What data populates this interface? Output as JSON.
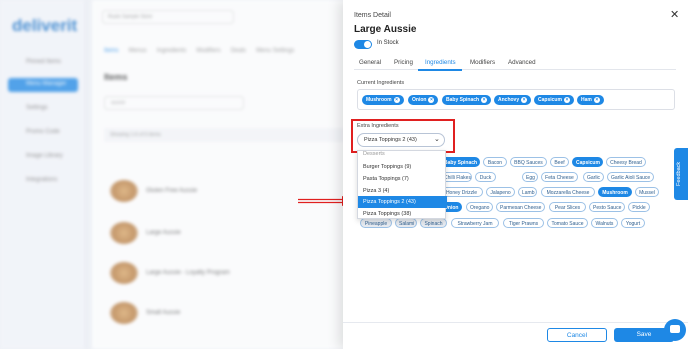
{
  "background": {
    "logo": "deliverit",
    "store_select": "Ruslo Sample Store",
    "nav": [
      "Pinned Items",
      "Menu Manager",
      "Settings",
      "Promo Code",
      "Image Library",
      "Integrations"
    ],
    "tabs": [
      "Items",
      "Menus",
      "Ingredients",
      "Modifiers",
      "Deals",
      "Menu Settings"
    ],
    "items_title": "Items",
    "search_value": "aussie",
    "showing": "Showing 1-6 of 6 items",
    "column": "Name",
    "rows": [
      "Gluten Free Aussie",
      "Large Aussie",
      "Large Aussie - Loyalty Program",
      "Small Aussie"
    ]
  },
  "panel": {
    "header": "Items Detail",
    "item_name": "Large Aussie",
    "in_stock_label": "In Stock",
    "tabs": [
      "General",
      "Pricing",
      "Ingredients",
      "Modifiers",
      "Advanced"
    ],
    "active_tab": "Ingredients",
    "current_label": "Current Ingredients",
    "current_ingredients": [
      "Mushroom",
      "Onion",
      "Baby Spinach",
      "Anchovy",
      "Capsicum",
      "Ham"
    ],
    "extra_label": "Extra Ingredients",
    "extra_selected": "Pizza Toppings 2 (43)",
    "dropdown_options": [
      "Desserts",
      "Burger Toppings (9)",
      "Pasta Toppings (7)",
      "Pizza 3 (4)",
      "Pizza Toppings 2 (43)",
      "Pizza Toppings (38)"
    ],
    "chips_row1": [
      "Baby Spinach",
      "Bacon",
      "BBQ Sauces",
      "Beef",
      "Capsicum",
      "Cheesy Bread"
    ],
    "chips_row2": [
      "Chilli Flakes",
      "Duck",
      "Egg",
      "Feta Cheese",
      "Garlic",
      "Garlic Aioli Sauce"
    ],
    "chips_row3": [
      "Honey Drizzle",
      "Jalapeno",
      "Lamb",
      "Mozzarella Cheese",
      "Mushroom",
      "Mussel"
    ],
    "chips_row4": [
      "Onion",
      "Oregano",
      "Parmesan Cheese",
      "Pear Slices",
      "Pesto Sauce",
      "Pickle"
    ],
    "chips_row5": [
      "Pineapple",
      "Salami",
      "Spinach",
      "Strawberry Jam",
      "Tiger Prawns",
      "Tomato Sauce",
      "Walnuts",
      "Yogurt"
    ],
    "cancel": "Cancel",
    "save": "Save",
    "feedback": "Feedback",
    "close_icon": "close-icon"
  },
  "colors": {
    "accent": "#1e88e5",
    "highlight_box": "#e02020"
  }
}
